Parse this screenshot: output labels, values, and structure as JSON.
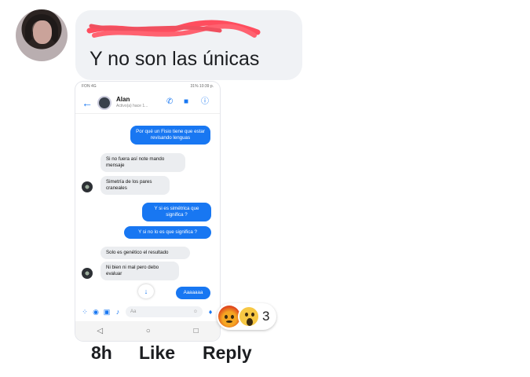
{
  "comment": {
    "text": "Y no son las únicas",
    "time": "8h",
    "like_label": "Like",
    "reply_label": "Reply",
    "reaction_count": "3",
    "reaction_icons": [
      "angry-reaction",
      "wow-reaction"
    ]
  },
  "screenshot": {
    "status_left": "FON 4G",
    "status_right": "31% 10:39 p.",
    "contact_name": "Alan",
    "contact_status": "Activo(a) hace 1...",
    "messages": [
      {
        "side": "out",
        "text": "Por qué un Fisio tiene que estar revisando lenguas"
      },
      {
        "side": "in",
        "text": "Si no fuera así note mando mensaje"
      },
      {
        "side": "in",
        "text": "Simetría de los pares craneales"
      },
      {
        "side": "out",
        "text": "Y si es simétrica que significa ?"
      },
      {
        "side": "out",
        "text": "Y si no lo es que significa ?"
      },
      {
        "side": "in",
        "text": "Solo es genético el resultado"
      },
      {
        "side": "in",
        "text": "Ni bien ni mal pero debo evaluar"
      },
      {
        "side": "out",
        "text": "Aaaaaaa"
      }
    ],
    "composer_placeholder": "Aa",
    "accent_color": "#1877f2"
  }
}
